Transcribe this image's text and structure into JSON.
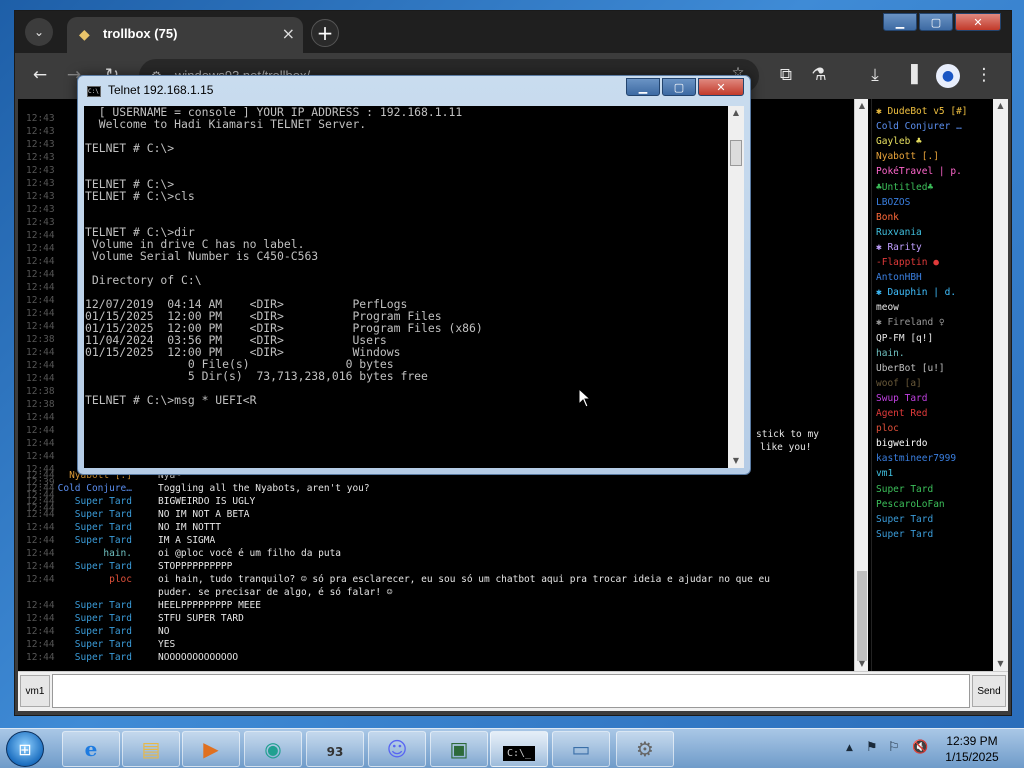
{
  "browser": {
    "tab_title": "trollbox (75)",
    "url": "windows93.net/trollbox/",
    "new_tab_label": "+",
    "tab_close": "×"
  },
  "telnet": {
    "title": "Telnet 192.168.1.15",
    "lines": [
      {
        "row": 0,
        "text": "  [ USERNAME = console ] YOUR IP ADDRESS : 192.168.1.11"
      },
      {
        "row": 1,
        "text": "  Welcome to Hadi Kiamarsi TELNET Server."
      },
      {
        "row": 3,
        "text": "TELNET # C:\\>"
      },
      {
        "row": 6,
        "text": "TELNET # C:\\>"
      },
      {
        "row": 7,
        "text": "TELNET # C:\\>cls"
      },
      {
        "row": 10,
        "text": "TELNET # C:\\>dir"
      },
      {
        "row": 11,
        "text": " Volume in drive C has no label."
      },
      {
        "row": 12,
        "text": " Volume Serial Number is C450-C563"
      },
      {
        "row": 14,
        "text": " Directory of C:\\"
      },
      {
        "row": 16,
        "text": "12/07/2019  04:14 AM    <DIR>          PerfLogs"
      },
      {
        "row": 17,
        "text": "01/15/2025  12:00 PM    <DIR>          Program Files"
      },
      {
        "row": 18,
        "text": "01/15/2025  12:00 PM    <DIR>          Program Files (x86)"
      },
      {
        "row": 19,
        "text": "11/04/2024  03:56 PM    <DIR>          Users"
      },
      {
        "row": 20,
        "text": "01/15/2025  12:00 PM    <DIR>          Windows"
      },
      {
        "row": 21,
        "text": "               0 File(s)              0 bytes"
      },
      {
        "row": 22,
        "text": "               5 Dir(s)  73,713,238,016 bytes free"
      },
      {
        "row": 24,
        "text": "TELNET # C:\\>msg * UEFI<R"
      }
    ]
  },
  "chat": {
    "peek_text": {
      "line1": "stick to my",
      "line2": "like you!"
    },
    "left_times": [
      "12:43",
      "12:43",
      "12:43",
      "12:43",
      "12:43",
      "12:43",
      "12:43",
      "12:43",
      "12:43",
      "12:44",
      "12:44",
      "12:44",
      "12:44",
      "12:44",
      "12:44",
      "12:44",
      "12:44",
      "12:38",
      "12:44",
      "12:44",
      "12:44",
      "12:38",
      "12:38",
      "12:44",
      "12:44",
      "12:44",
      "12:44",
      "12:44",
      "12:39",
      "12:44",
      "12:44"
    ],
    "messages": [
      {
        "time": "12:44",
        "nick": "Nyabott [.]",
        "nick_color": "#e8a33a",
        "text": "Nya~"
      },
      {
        "time": "12:44",
        "nick": "Cold Conjure…",
        "nick_color": "#5b8ff0",
        "text": "Toggling all the Nyabots, aren't you?"
      },
      {
        "time": "12:44",
        "nick": "Super Tard",
        "nick_color": "#3b9cd9",
        "text": "BIGWEIRDO IS UGLY"
      },
      {
        "time": "12:44",
        "nick": "Super Tard",
        "nick_color": "#3b9cd9",
        "text": "NO IM NOT A BETA"
      },
      {
        "time": "12:44",
        "nick": "Super Tard",
        "nick_color": "#3b9cd9",
        "text": "NO IM NOTTT"
      },
      {
        "time": "12:44",
        "nick": "Super Tard",
        "nick_color": "#3b9cd9",
        "text": "IM A SIGMA"
      },
      {
        "time": "12:44",
        "nick": "hain.",
        "nick_color": "#6fc0c0",
        "text": "oi @ploc você é um filho da puta"
      },
      {
        "time": "12:44",
        "nick": "Super Tard",
        "nick_color": "#3b9cd9",
        "text": "STOPPPPPPPPPP"
      },
      {
        "time": "12:44",
        "nick": "ploc",
        "nick_color": "#e0503a",
        "text": "oi hain, tudo tranquilo? ☺ só pra esclarecer, eu sou só um chatbot aqui pra trocar ideia e ajudar no que eu"
      },
      {
        "time": "",
        "nick": "",
        "nick_color": "#e0503a",
        "text": "puder. se precisar de algo, é só falar! ☺"
      },
      {
        "time": "12:44",
        "nick": "Super Tard",
        "nick_color": "#3b9cd9",
        "text": "HEELPPPPPPPPP MEEE"
      },
      {
        "time": "12:44",
        "nick": "Super Tard",
        "nick_color": "#3b9cd9",
        "text": "STFU SUPER TARD"
      },
      {
        "time": "12:44",
        "nick": "Super Tard",
        "nick_color": "#3b9cd9",
        "text": "NO"
      },
      {
        "time": "12:44",
        "nick": "Super Tard",
        "nick_color": "#3b9cd9",
        "text": "YES"
      },
      {
        "time": "12:44",
        "nick": "Super Tard",
        "nick_color": "#3b9cd9",
        "text": "NOOOOOOOOOOOOO"
      }
    ]
  },
  "users": [
    {
      "name": "✱ DudeBot v5 [#]",
      "color": "#f0c040"
    },
    {
      "name": "Cold Conjurer …",
      "color": "#5b8ff0"
    },
    {
      "name": "Gayleb ♣",
      "color": "#e8e060"
    },
    {
      "name": "Nyabott [.]",
      "color": "#e8a33a"
    },
    {
      "name": "PokéTravel | p.",
      "color": "#ff66cc"
    },
    {
      "name": "♣Untitled♣",
      "color": "#3cbf5a"
    },
    {
      "name": "LBOZOS",
      "color": "#3a7fe0"
    },
    {
      "name": "Bonk",
      "color": "#ff6a3a"
    },
    {
      "name": "Ruxvania",
      "color": "#40c0e0"
    },
    {
      "name": "✱ Rarity",
      "color": "#c0a0ff"
    },
    {
      "name": "-Flapptin ●",
      "color": "#e03a3a"
    },
    {
      "name": "AntonHBH",
      "color": "#3a7fe0"
    },
    {
      "name": "✱ Dauphin | d.",
      "color": "#40c0ff"
    },
    {
      "name": "meow",
      "color": "#e8e8e8"
    },
    {
      "name": "✱ Fireland ♀",
      "color": "#9a9a9a"
    },
    {
      "name": "QP-FM [q!]",
      "color": "#e8e8e8"
    },
    {
      "name": "hain.",
      "color": "#6fc0c0"
    },
    {
      "name": "UberBot [u!]",
      "color": "#c0c0c0"
    },
    {
      "name": "woof [a]",
      "color": "#6a5a3a"
    },
    {
      "name": "Swup Tard",
      "color": "#c040e0"
    },
    {
      "name": "Agent Red",
      "color": "#e03a3a"
    },
    {
      "name": "ploc",
      "color": "#e0503a"
    },
    {
      "name": "bigweirdo",
      "color": "#ffffff"
    },
    {
      "name": "kastmineer7999",
      "color": "#3a7fe0"
    },
    {
      "name": "vm1",
      "color": "#40c0e0"
    },
    {
      "name": "Super Tard",
      "color": "#3cbf5a"
    },
    {
      "name": "PescaroLoFan",
      "color": "#3cbf5a"
    },
    {
      "name": "Super Tard",
      "color": "#3b9cd9"
    },
    {
      "name": "Super Tard",
      "color": "#3b9cd9"
    }
  ],
  "input": {
    "nick_label": "vm1",
    "send_label": "Send",
    "value": ""
  },
  "taskbar": {
    "time": "12:39 PM",
    "date": "1/15/2025",
    "items": [
      "internet-explorer-icon",
      "file-explorer-icon",
      "media-player-icon",
      "app-icon",
      "windows93-icon",
      "discord-icon",
      "monitor-tool-icon",
      "cmd-icon",
      "remote-desktop-icon",
      "hardware-wizard-icon"
    ]
  }
}
